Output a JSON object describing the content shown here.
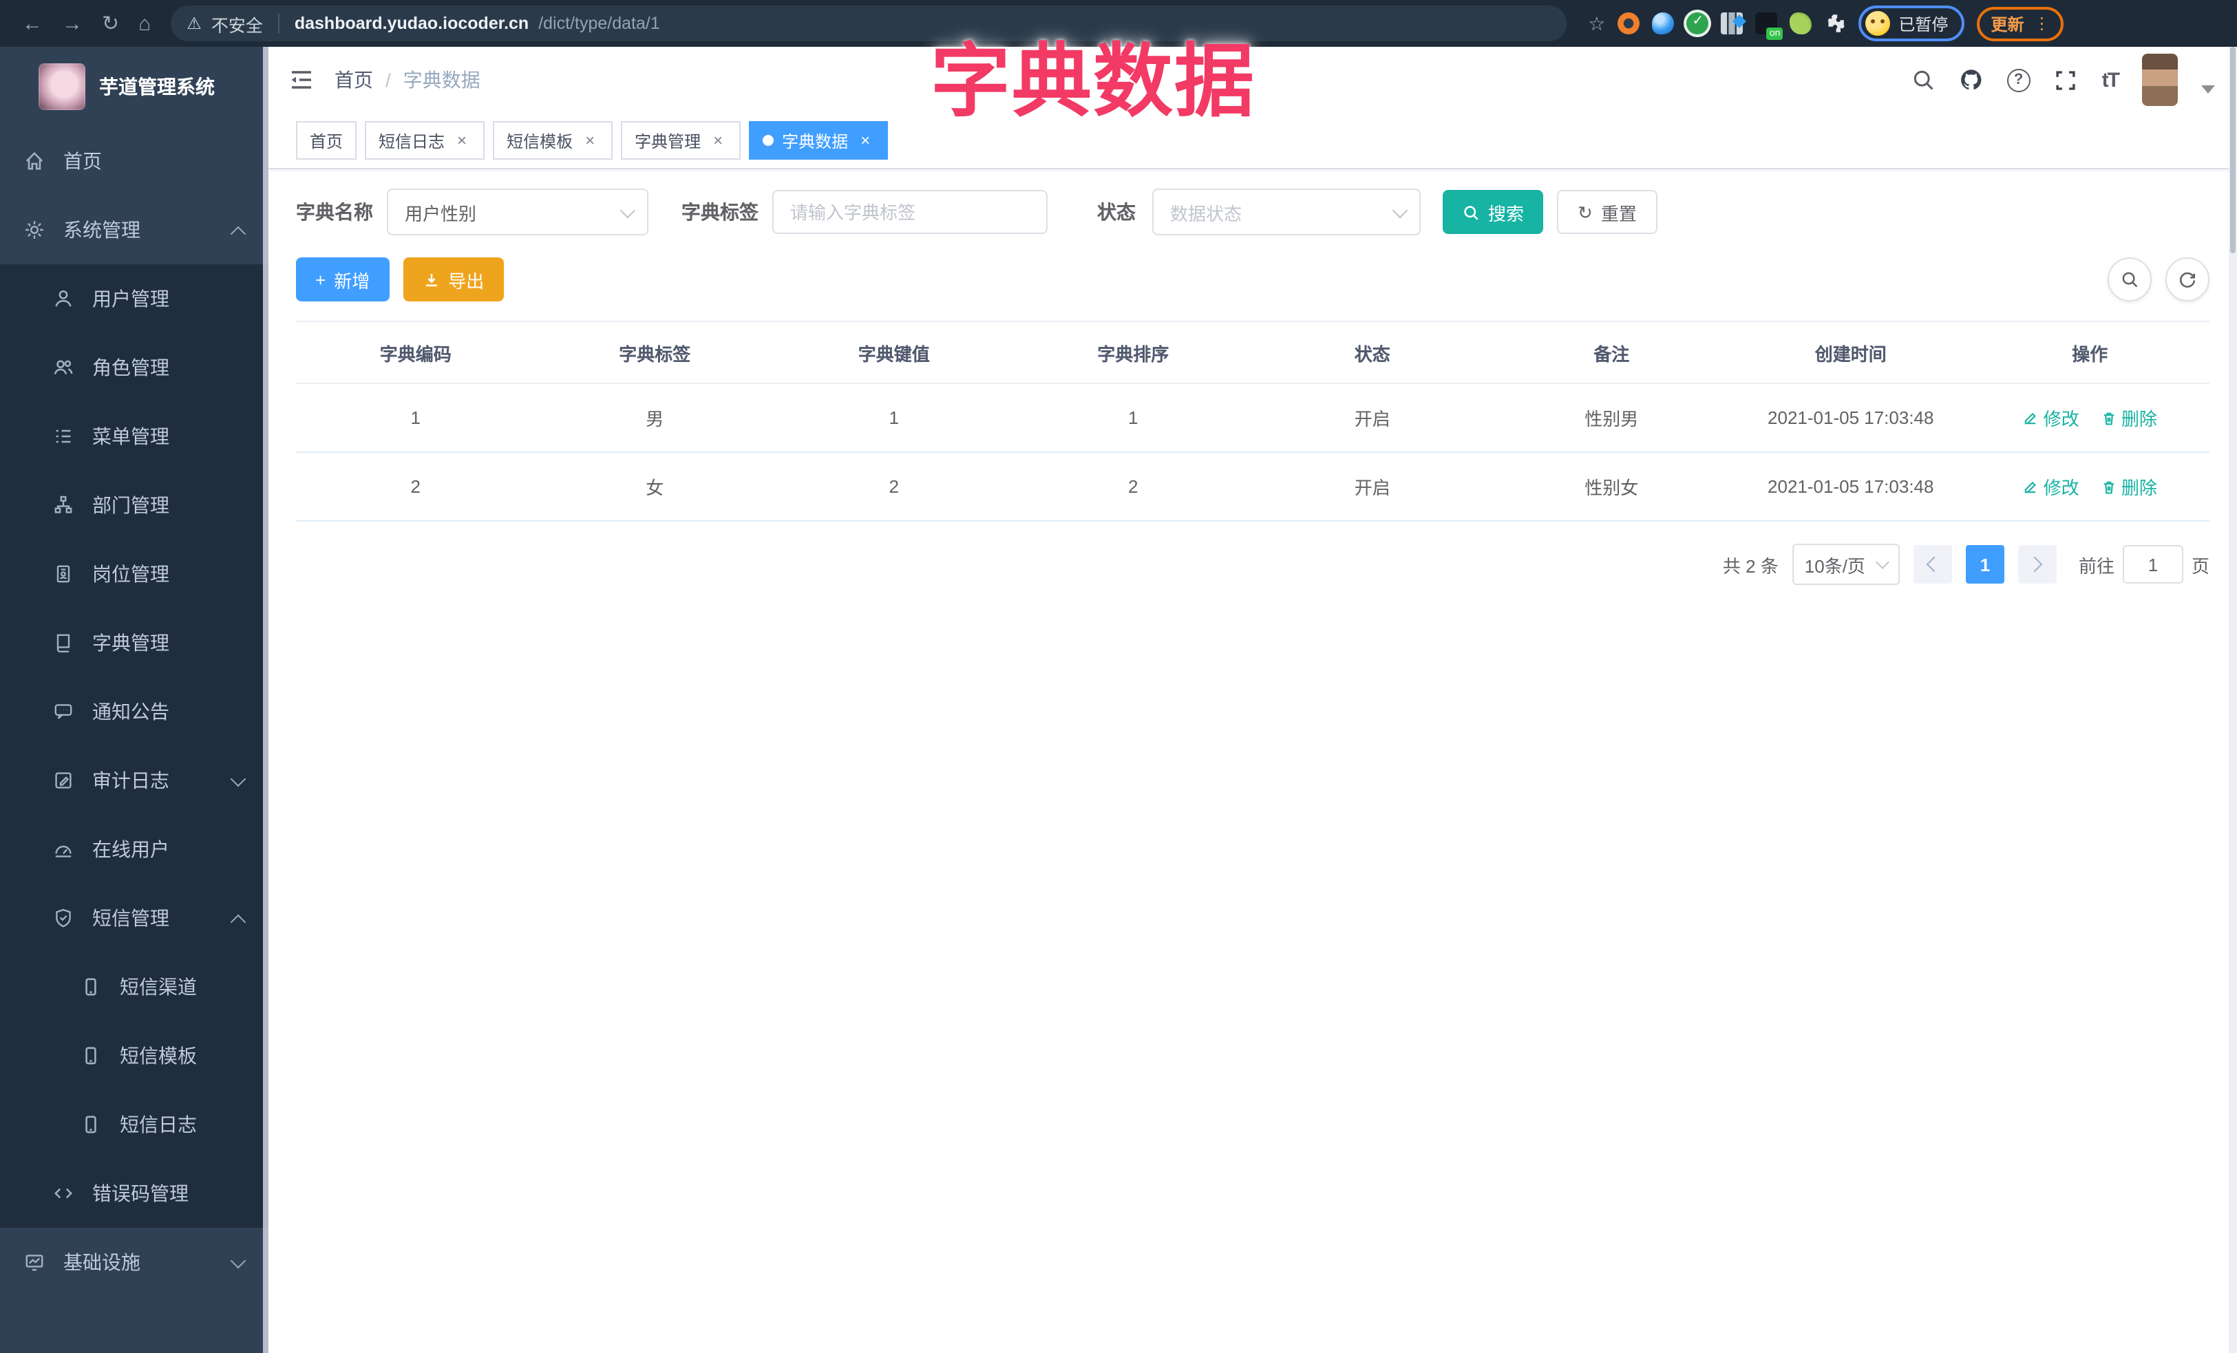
{
  "annotation": {
    "title": "字典数据"
  },
  "colors": {
    "primary": "#409EFF",
    "teal_action": "#17b3a3",
    "warning_export": "#efa41d",
    "annotation_pink": "#f23a65",
    "sidebar_bg": "#304156",
    "submenu_bg": "#1f2d3d",
    "active_tab_bg": "#409EFF"
  },
  "browser": {
    "security_label": "不安全",
    "url_host": "dashboard.yudao.iocoder.cn",
    "url_path": "/dict/type/data/1",
    "profile_status": "已暂停",
    "update_label": "更新",
    "update_menu": "⋮",
    "extension_badge": "on",
    "back_icon": "←",
    "forward_icon": "→",
    "reload_icon": "↻",
    "home_icon": "⌂",
    "warning_icon": "⚠",
    "star_icon": "☆"
  },
  "sidebar": {
    "logo_title": "芋道管理系统",
    "items": [
      {
        "label": "首页",
        "icon": "home",
        "level": 1
      },
      {
        "label": "系统管理",
        "icon": "gear",
        "level": 1,
        "caret": "up"
      },
      {
        "label": "用户管理",
        "icon": "user",
        "level": 2
      },
      {
        "label": "角色管理",
        "icon": "users",
        "level": 2
      },
      {
        "label": "菜单管理",
        "icon": "menu-list",
        "level": 2
      },
      {
        "label": "部门管理",
        "icon": "org-tree",
        "level": 2
      },
      {
        "label": "岗位管理",
        "icon": "id-badge",
        "level": 2
      },
      {
        "label": "字典管理",
        "icon": "book",
        "level": 2
      },
      {
        "label": "通知公告",
        "icon": "message-bubble",
        "level": 2
      },
      {
        "label": "审计日志",
        "icon": "edit-note",
        "level": 2,
        "caret": "down"
      },
      {
        "label": "在线用户",
        "icon": "gauge",
        "level": 2
      },
      {
        "label": "短信管理",
        "icon": "shield-check",
        "level": 2,
        "caret": "up"
      },
      {
        "label": "短信渠道",
        "icon": "phone",
        "level": 3
      },
      {
        "label": "短信模板",
        "icon": "phone",
        "level": 3
      },
      {
        "label": "短信日志",
        "icon": "phone",
        "level": 3
      },
      {
        "label": "错误码管理",
        "icon": "code",
        "level": 2
      },
      {
        "label": "基础设施",
        "icon": "chart-monitor",
        "level": 1,
        "caret": "down"
      }
    ]
  },
  "header": {
    "breadcrumb": {
      "home": "首页",
      "separator": "/",
      "current": "字典数据"
    },
    "font_size_icon": "tT",
    "help_icon": "?"
  },
  "tabs": {
    "items": [
      {
        "label": "首页",
        "closable": false,
        "active": false
      },
      {
        "label": "短信日志",
        "closable": true,
        "active": false
      },
      {
        "label": "短信模板",
        "closable": true,
        "active": false
      },
      {
        "label": "字典管理",
        "closable": true,
        "active": false
      },
      {
        "label": "字典数据",
        "closable": true,
        "active": true
      }
    ],
    "close_glyph": "×"
  },
  "filters": {
    "name_label": "字典名称",
    "name_value": "用户性别",
    "tag_label": "字典标签",
    "tag_placeholder": "请输入字典标签",
    "status_label": "状态",
    "status_placeholder": "数据状态",
    "search_label": "搜索",
    "reset_label": "重置"
  },
  "toolbar": {
    "add_label": "新增",
    "add_icon": "+",
    "export_label": "导出"
  },
  "table": {
    "columns": [
      "字典编码",
      "字典标签",
      "字典键值",
      "字典排序",
      "状态",
      "备注",
      "创建时间",
      "操作"
    ],
    "rows": [
      {
        "code": "1",
        "label": "男",
        "value": "1",
        "sort": "1",
        "status": "开启",
        "remark": "性别男",
        "created": "2021-01-05 17:03:48"
      },
      {
        "code": "2",
        "label": "女",
        "value": "2",
        "sort": "2",
        "status": "开启",
        "remark": "性别女",
        "created": "2021-01-05 17:03:48"
      }
    ],
    "edit_label": "修改",
    "delete_label": "删除"
  },
  "pagination": {
    "total_text": "共 2 条",
    "page_size": "10条/页",
    "current_page": "1",
    "goto_label": "前往",
    "goto_value": "1",
    "unit_label": "页"
  }
}
